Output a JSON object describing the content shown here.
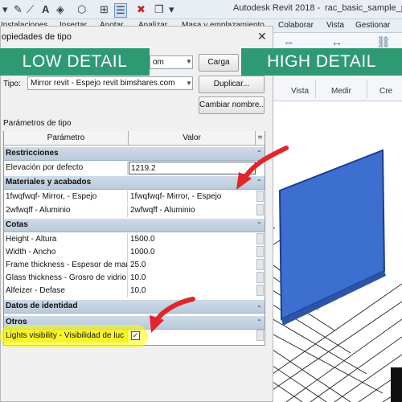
{
  "app": {
    "title": "Autodesk Revit 2018 -",
    "file": "rac_basic_sample_p",
    "qat_icons": [
      "caret-down-icon",
      "pencil-icon",
      "line-icon",
      "text-icon",
      "cube-icon",
      "select-icon",
      "delete-icon",
      "window-icon",
      "caret-down-icon"
    ]
  },
  "ribbon": {
    "tabs": [
      "Instalaciones",
      "Insertar",
      "Anotar",
      "Analizar",
      "Masa y emplazamiento",
      "Colaborar",
      "Vista",
      "Gestionar"
    ],
    "groups": [
      "Vista",
      "Medir",
      "Cre"
    ]
  },
  "banners": {
    "low": "LOW DETAIL",
    "high": "HIGH DETAIL"
  },
  "dialog": {
    "title": "opiedades de tipo",
    "close_glyph": "✕",
    "family_value": "om",
    "type_label": "Tipo:",
    "type_value": "Mirror revit - Espejo revit bimshares.com",
    "buttons": {
      "load": "Carga",
      "duplicate": "Duplicar...",
      "rename": "Cambiar nombre..."
    },
    "params_label": "Parámetros de tipo",
    "columns": {
      "param": "Parámetro",
      "value": "Valor",
      "extra": "="
    },
    "sections": [
      {
        "title": "Restricciones",
        "rows": [
          {
            "param": "Elevación por defecto",
            "value": "1219.2"
          }
        ]
      },
      {
        "title": "Materiales y acabados",
        "rows": [
          {
            "param": "1fwqfwqf- Mirror, - Espejo",
            "value": "1fwqfwqf- Mirror, - Espejo"
          },
          {
            "param": "2wfwqff - Aluminio",
            "value": "2wfwqff - Aluminio"
          }
        ]
      },
      {
        "title": "Cotas",
        "rows": [
          {
            "param": "Height - Altura",
            "value": "1500.0"
          },
          {
            "param": "Width - Ancho",
            "value": "1000.0"
          },
          {
            "param": "Frame thickness - Espesor de marc",
            "value": "25.0"
          },
          {
            "param": "Glass thickness - Grosro de vidrio",
            "value": "10.0"
          },
          {
            "param": "Alfeizer - Defase",
            "value": "10.0"
          }
        ]
      },
      {
        "title": "Datos de identidad",
        "rows": []
      },
      {
        "title": "Otros",
        "rows": [
          {
            "param": "Lights visibility - Visibilidad de luc",
            "value": "✓"
          }
        ]
      }
    ]
  },
  "colors": {
    "banner": "#2e9a74",
    "arrow": "#e0262a",
    "mirror": "#3d6fd1",
    "highlight": "#f7f42a"
  }
}
